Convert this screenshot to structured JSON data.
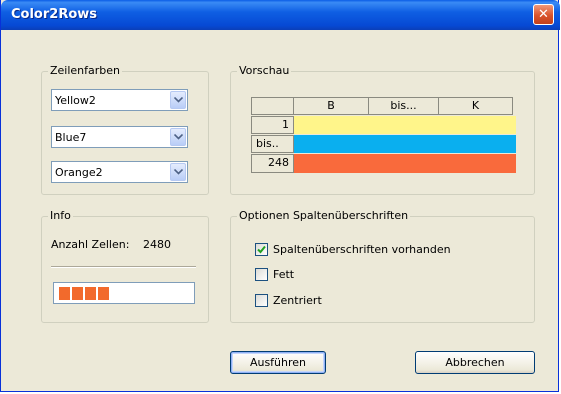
{
  "window": {
    "title": "Color2Rows",
    "close_glyph": "✕"
  },
  "zeilenfarben": {
    "legend": "Zeilenfarben",
    "combos": [
      {
        "value": "Yellow2"
      },
      {
        "value": "Blue7"
      },
      {
        "value": "Orange2"
      }
    ]
  },
  "vorschau": {
    "legend": "Vorschau",
    "columns": [
      "B",
      "bis...",
      "K"
    ],
    "rows": [
      {
        "label": "1",
        "color": "#fff58a"
      },
      {
        "label": "bis..",
        "color": "#0aafef"
      },
      {
        "label": "248",
        "color": "#f96a3c"
      }
    ]
  },
  "info": {
    "legend": "Info",
    "count_label": "Anzahl Zellen:",
    "count_value": "2480",
    "progress_fraction": 0.42
  },
  "optionen": {
    "legend": "Optionen Spaltenüberschriften",
    "options": [
      {
        "label": "Spaltenüberschriften vorhanden",
        "checked": true
      },
      {
        "label": "Fett",
        "checked": false
      },
      {
        "label": "Zentriert",
        "checked": false
      }
    ]
  },
  "buttons": {
    "run_label": "Ausführen",
    "cancel_label": "Abbrechen"
  }
}
